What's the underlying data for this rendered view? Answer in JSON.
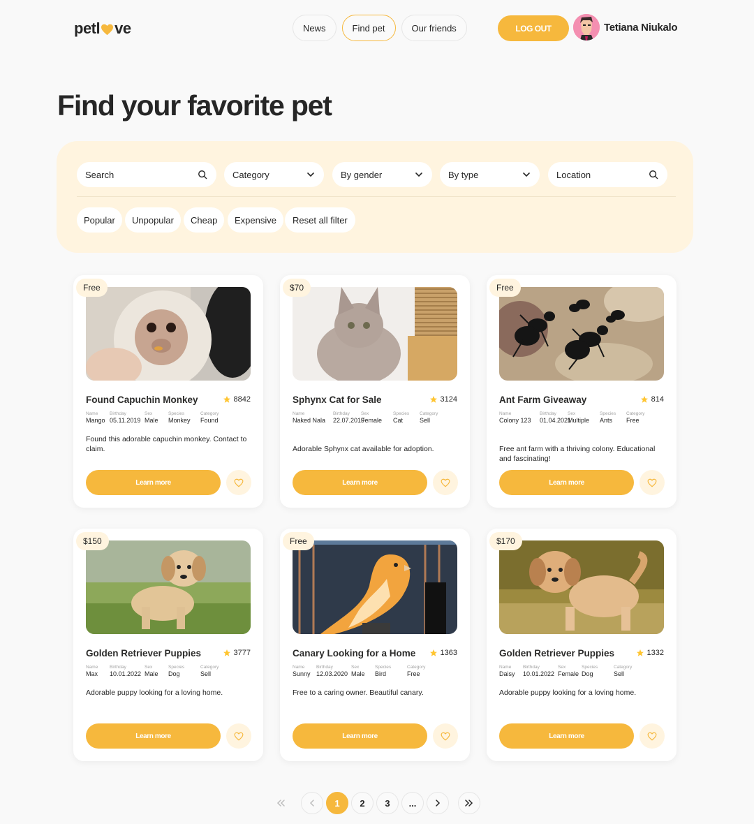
{
  "header": {
    "logo_left": "petl",
    "logo_right": "ve",
    "nav": [
      "News",
      "Find pet",
      "Our friends"
    ],
    "logout_label": "LOG OUT",
    "user_name": "Tetiana Niukalo"
  },
  "page_title": "Find your favorite pet",
  "filters": {
    "search_placeholder": "Search",
    "category": "Category",
    "gender": "By gender",
    "type": "By type",
    "location_placeholder": "Location",
    "sort": [
      "Popular",
      "Unpopular",
      "Cheap",
      "Expensive"
    ],
    "reset": "Reset all filter"
  },
  "meta_labels": {
    "name": "Name",
    "birthday": "Birthday",
    "sex": "Sex",
    "species": "Species",
    "category": "Category"
  },
  "learn_more": "Learn more",
  "cards": [
    {
      "price": "Free",
      "title": "Found Capuchin Monkey",
      "rating": "8842",
      "name": "Mango",
      "birthday": "05.11.2019",
      "sex": "Male",
      "species": "Monkey",
      "category": "Found",
      "desc": "Found this adorable capuchin monkey. Contact to claim.",
      "image": "monkey"
    },
    {
      "price": "$70",
      "title": "Sphynx Cat for Sale",
      "rating": "3124",
      "name": "Naked Nala",
      "birthday": "22.07.2019",
      "sex": "Female",
      "species": "Cat",
      "category": "Sell",
      "desc": "Adorable Sphynx cat available for adoption.",
      "image": "cat"
    },
    {
      "price": "Free",
      "title": "Ant Farm Giveaway",
      "rating": "814",
      "name": "Colony 123",
      "birthday": "01.04.2021",
      "sex": "Multiple",
      "species": "Ants",
      "category": "Free",
      "desc": "Free ant farm with a thriving colony. Educational and fascinating!",
      "image": "ants"
    },
    {
      "price": "$150",
      "title": "Golden Retriever Puppies",
      "rating": "3777",
      "name": "Max",
      "birthday": "10.01.2022",
      "sex": "Male",
      "species": "Dog",
      "category": "Sell",
      "desc": "Adorable puppy looking for a loving home.",
      "image": "puppy1"
    },
    {
      "price": "Free",
      "title": "Canary Looking for a Home",
      "rating": "1363",
      "name": "Sunny",
      "birthday": "12.03.2020",
      "sex": "Male",
      "species": "Bird",
      "category": "Free",
      "desc": "Free to a caring owner. Beautiful canary.",
      "image": "canary"
    },
    {
      "price": "$170",
      "title": "Golden Retriever Puppies",
      "rating": "1332",
      "name": "Daisy",
      "birthday": "10.01.2022",
      "sex": "Female",
      "species": "Dog",
      "category": "Sell",
      "desc": "Adorable puppy looking for a loving home.",
      "image": "puppy2"
    }
  ],
  "pagination": {
    "pages": [
      "1",
      "2",
      "3",
      "..."
    ],
    "current": "1"
  },
  "colors": {
    "accent": "#f6b83d",
    "accent_light": "#fff4df",
    "text": "#262626",
    "background": "#f9f9f9"
  }
}
